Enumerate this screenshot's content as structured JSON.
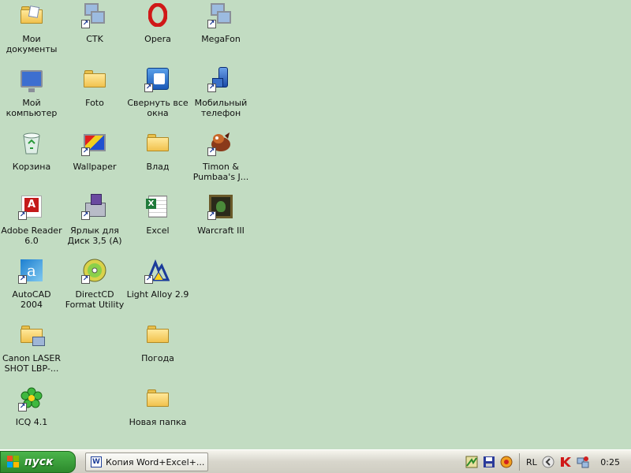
{
  "desktop": {
    "icons": [
      {
        "label": "Мои документы",
        "icon": "my-documents-folder-icon"
      },
      {
        "label": "Мой компьютер",
        "icon": "my-computer-icon"
      },
      {
        "label": "Корзина",
        "icon": "recycle-bin-icon"
      },
      {
        "label": "Adobe Reader 6.0",
        "icon": "adobe-reader-icon"
      },
      {
        "label": "AutoCAD 2004",
        "icon": "autocad-icon"
      },
      {
        "label": "Canon LASER SHOT LBP-...",
        "icon": "printer-folder-icon"
      },
      {
        "label": "ICQ 4.1",
        "icon": "icq-flower-icon"
      },
      {
        "label": "CTK",
        "icon": "network-computers-icon"
      },
      {
        "label": "Foto",
        "icon": "folder-icon"
      },
      {
        "label": "Wallpaper",
        "icon": "wallpaper-monitor-icon"
      },
      {
        "label": "Ярлык для Диск 3,5 (A)",
        "icon": "floppy-drive-icon"
      },
      {
        "label": "DirectCD Format Utility",
        "icon": "cd-disc-icon"
      },
      {
        "label": "Opera",
        "icon": "opera-icon"
      },
      {
        "label": "Свернуть все окна",
        "icon": "show-desktop-icon"
      },
      {
        "label": "Влад",
        "icon": "folder-icon"
      },
      {
        "label": "Excel",
        "icon": "excel-icon"
      },
      {
        "label": "Light Alloy 2.9",
        "icon": "light-alloy-icon"
      },
      {
        "label": "Погода",
        "icon": "folder-icon"
      },
      {
        "label": "Новая папка",
        "icon": "folder-icon"
      },
      {
        "label": "MegaFon",
        "icon": "network-computers-icon"
      },
      {
        "label": "Мобильный телефон",
        "icon": "mobile-phone-icon"
      },
      {
        "label": "Timon & Pumbaa's J...",
        "icon": "timon-game-icon"
      },
      {
        "label": "Warcraft III",
        "icon": "warcraft-icon"
      }
    ]
  },
  "taskbar": {
    "start_label": "пуск",
    "task_item_label": "Копия  Word+Excel+...",
    "tray": {
      "language": "RL",
      "clock": "0:25",
      "icons": [
        "network-activity-icon",
        "floppy-save-icon",
        "media-player-icon",
        "collapse-arrow-icon",
        "kaspersky-icon",
        "network-connection-icon"
      ]
    }
  },
  "colors": {
    "desktop_background": "#c2dcc2",
    "start_button": "#3a9e3a",
    "taskbar": "#d8d6cc"
  }
}
